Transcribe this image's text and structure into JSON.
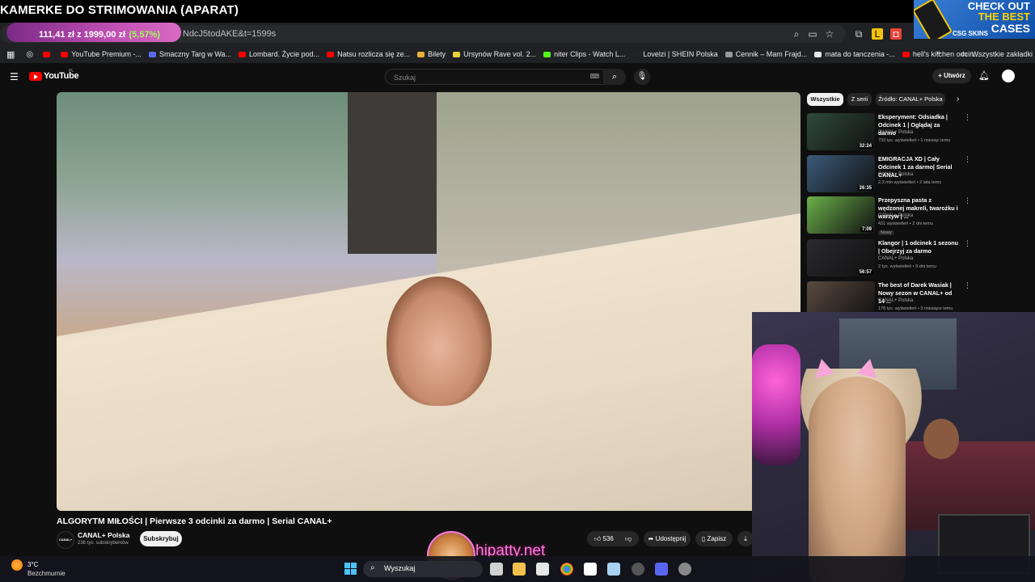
{
  "stream": {
    "title": "KAMERKE DO STRIMOWANIA (APARAT)",
    "goal_text": "111,41 zł z 1999,00 zł",
    "goal_percent": "(5,57%)",
    "goal_fraction": 0.0557,
    "watermark": "hipatty.net"
  },
  "browser": {
    "url_fragment": "NdcJ5todAKE&t=1599s",
    "bookmarks": [
      {
        "label": "",
        "color": "#ff0000"
      },
      {
        "label": "YouTube Premium -...",
        "color": "#ff0000"
      },
      {
        "label": "Smaczny Targ w Wa...",
        "color": "#5b6bf0"
      },
      {
        "label": "Lombard. Życie pod...",
        "color": "#ff0000"
      },
      {
        "label": "Natsu rozlicza się ze...",
        "color": "#ff0000"
      },
      {
        "label": "Bilety",
        "color": "#e8b03a"
      },
      {
        "label": "Ursynów Rave vol. 2...",
        "color": "#e8d23a"
      },
      {
        "label": "niter Clips - Watch L...",
        "color": "#53fc18"
      },
      {
        "label": "Lovelzi | SHEIN Polska",
        "color": "#222222"
      },
      {
        "label": "Cennik – Mam Frajd...",
        "color": "#999999"
      },
      {
        "label": "mata do tanczenia -...",
        "color": "#e8e8e8"
      },
      {
        "label": "hell's kitchen odcin...",
        "color": "#ff0000"
      }
    ],
    "all_bookmarks": "Wszystkie zakładki"
  },
  "ad": {
    "line1": "CHECK OUT",
    "line2": "THE BEST",
    "line3": "CASES",
    "brand": "CSG SKINS"
  },
  "youtube": {
    "logo": "YouTube",
    "country": "PL",
    "search_placeholder": "Szukaj",
    "create": "Utwórz",
    "video_title": "ALGORYTM MIŁOŚCI | Pierwsze 3 odcinki za darmo | Serial CANAL+",
    "channel": "CANAL+ Polska",
    "channel_avatar_text": "CANAL+",
    "subscribers": "236 tys. subskrybentów",
    "subscribe": "Subskrybuj",
    "likes": "536",
    "share": "Udostępnij",
    "save": "Zapisz",
    "chips": [
      "Wszystkie",
      "Z serii",
      "Źródło: CANAL+ Polska"
    ],
    "recommendations": [
      {
        "title": "Eksperyment: Odsiadka | Odcinek 1 | Oglądaj za darmo",
        "channel": "CANAL+ Polska",
        "meta": "733 tys. wyświetleń • 1 miesiąc temu",
        "duration": "32:24",
        "thumb_color": "#2f4a3b",
        "badge": ""
      },
      {
        "title": "EMIGRACJA XD | Cały Odcinek 1 za darmo| Serial CANAL+",
        "channel": "CANAL+ Polska",
        "meta": "2,3 mln wyświetleń • 2 lata temu",
        "duration": "26:35",
        "thumb_color": "#3c5b7a",
        "badge": ""
      },
      {
        "title": "Przepyszna pasta z wędzonej makreli, twarożku i warzyw | ...",
        "channel": "CANAL+ Polska",
        "meta": "431 wyświetleń • 2 dni temu",
        "duration": "7:09",
        "thumb_color": "#6bb04a",
        "badge": "Nowy"
      },
      {
        "title": "Klangor | 1 odcinek 1 sezonu | Obejrzyj za darmo",
        "channel": "CANAL+ Polska",
        "meta": "2 tys. wyświetleń • 9 dni temu",
        "duration": "56:57",
        "thumb_color": "#2a2a2e",
        "badge": ""
      },
      {
        "title": "The best of Darek Wasiak | Nowy sezon w CANAL+ od 14 ...",
        "channel": "CANAL+ Polska",
        "meta": "178 tys. wyświetleń • 3 miesiące temu",
        "duration": "",
        "thumb_color": "#5a4a3f",
        "badge": ""
      }
    ]
  },
  "taskbar": {
    "temperature": "3°C",
    "weather": "Bezchmurnie",
    "search": "Wyszukaj"
  }
}
